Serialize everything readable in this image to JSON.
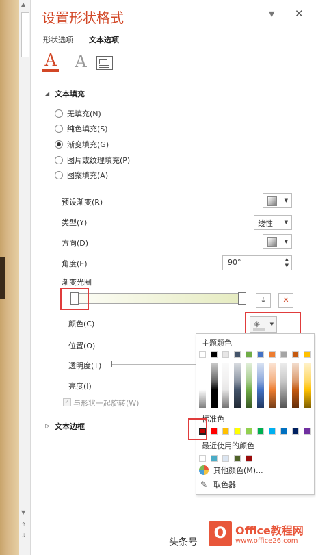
{
  "pane": {
    "title": "设置形状格式",
    "tabs": [
      {
        "label": "形状选项",
        "active": false
      },
      {
        "label": "文本选项",
        "active": true
      }
    ],
    "icons": [
      "text-fill-outline-icon",
      "text-effects-icon",
      "textbox-layout-icon"
    ]
  },
  "text_fill": {
    "title": "文本填充",
    "options": [
      {
        "label": "无填充(N)",
        "selected": false
      },
      {
        "label": "纯色填充(S)",
        "selected": false
      },
      {
        "label": "渐变填充(G)",
        "selected": true
      },
      {
        "label": "图片或纹理填充(P)",
        "selected": false
      },
      {
        "label": "图案填充(A)",
        "selected": false
      }
    ],
    "preset_label": "预设渐变(R)",
    "type_label": "类型(Y)",
    "type_value": "线性",
    "direction_label": "方向(D)",
    "angle_label": "角度(E)",
    "angle_value": "90°",
    "stops_label": "渐变光圈",
    "color_label": "颜色(C)",
    "position_label": "位置(O)",
    "transparency_label": "透明度(T)",
    "brightness_label": "亮度(I)",
    "rotate_label": "与形状一起旋转(W)"
  },
  "text_border": {
    "title": "文本边框"
  },
  "color_popup": {
    "theme_title": "主题颜色",
    "theme_colors": [
      "#ffffff",
      "#000000",
      "#e7e6e6",
      "#44546a",
      "#70ad47",
      "#4472c4",
      "#ed7d31",
      "#a5a5a5",
      "#c55a11",
      "#ffc000"
    ],
    "standard_title": "标准色",
    "standard_colors": [
      "#c00000",
      "#ff0000",
      "#ffc000",
      "#ffff00",
      "#92d050",
      "#00b050",
      "#00b0f0",
      "#0070c0",
      "#002060",
      "#7030a0"
    ],
    "recent_title": "最近使用的颜色",
    "recent_colors": [
      "#ffffff",
      "#4bacc6",
      "#dbe5f1",
      "#4f6228",
      "#9b0b0b"
    ],
    "more_colors": "其他颜色(M)...",
    "eyedropper": "取色器"
  },
  "watermark": {
    "left_text": "头条号",
    "brand_text": "Office教程网",
    "url_text": "www.office26.com"
  }
}
